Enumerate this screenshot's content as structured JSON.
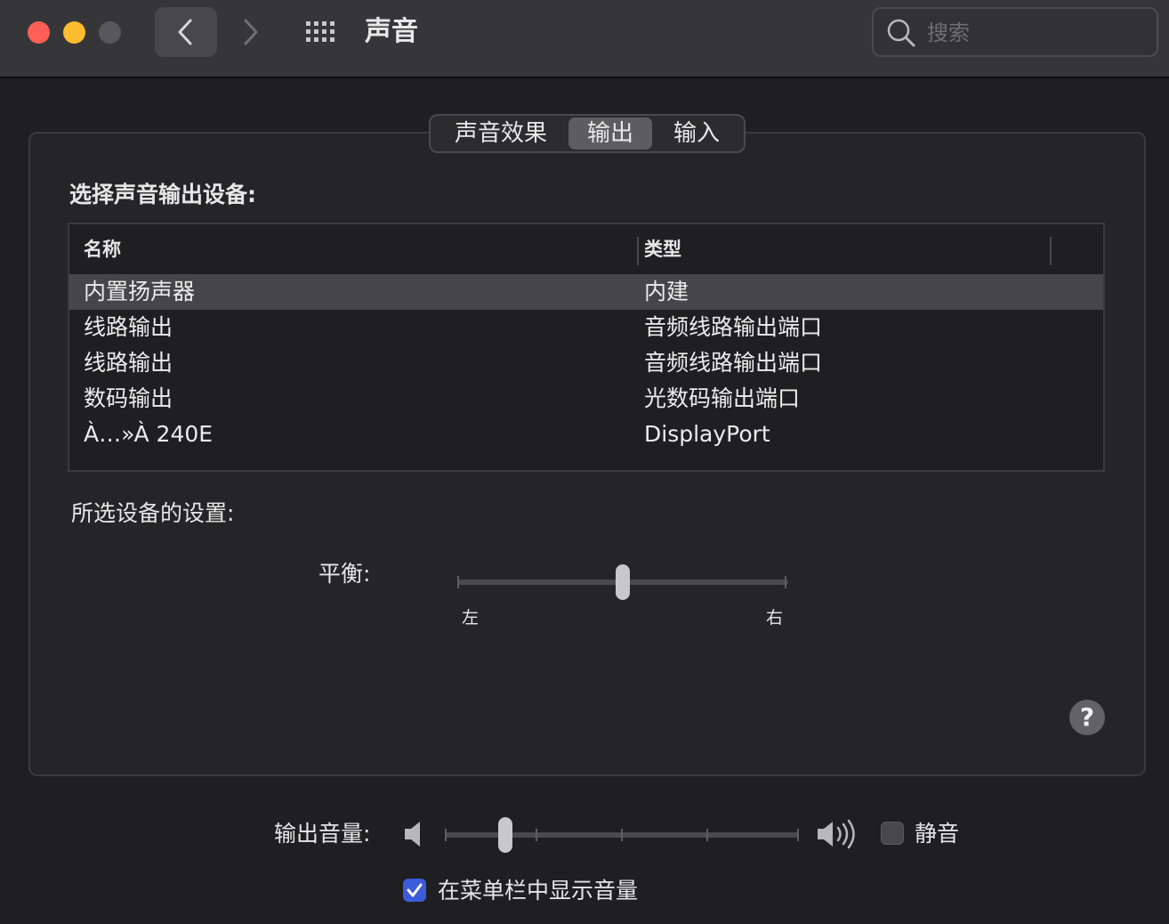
{
  "window": {
    "title": "声音",
    "search_placeholder": "搜索"
  },
  "tabs": [
    {
      "label": "声音效果",
      "active": false
    },
    {
      "label": "输出",
      "active": true
    },
    {
      "label": "输入",
      "active": false
    }
  ],
  "output": {
    "section_title": "选择声音输出设备:",
    "columns": [
      "名称",
      "类型"
    ],
    "devices": [
      {
        "name": "内置扬声器",
        "type": "内建",
        "selected": true
      },
      {
        "name": "线路输出",
        "type": "音频线路输出端口",
        "selected": false
      },
      {
        "name": "线路输出",
        "type": "音频线路输出端口",
        "selected": false
      },
      {
        "name": "数码输出",
        "type": "光数码输出端口",
        "selected": false
      },
      {
        "name": "À…»À 240E",
        "type": "DisplayPort",
        "selected": false
      }
    ]
  },
  "settings": {
    "section_title": "所选设备的设置:",
    "balance_label": "平衡:",
    "balance_value": 0.5,
    "balance_left": "左",
    "balance_right": "右"
  },
  "help_symbol": "?",
  "volume": {
    "label": "输出音量:",
    "value": 0.17,
    "mute_label": "静音",
    "mute_checked": false
  },
  "menubar": {
    "label": "在菜单栏中显示音量",
    "checked": true
  },
  "colors": {
    "accent": "#3b5bd8",
    "close": "#fe5f57",
    "minimize": "#febc2e"
  }
}
